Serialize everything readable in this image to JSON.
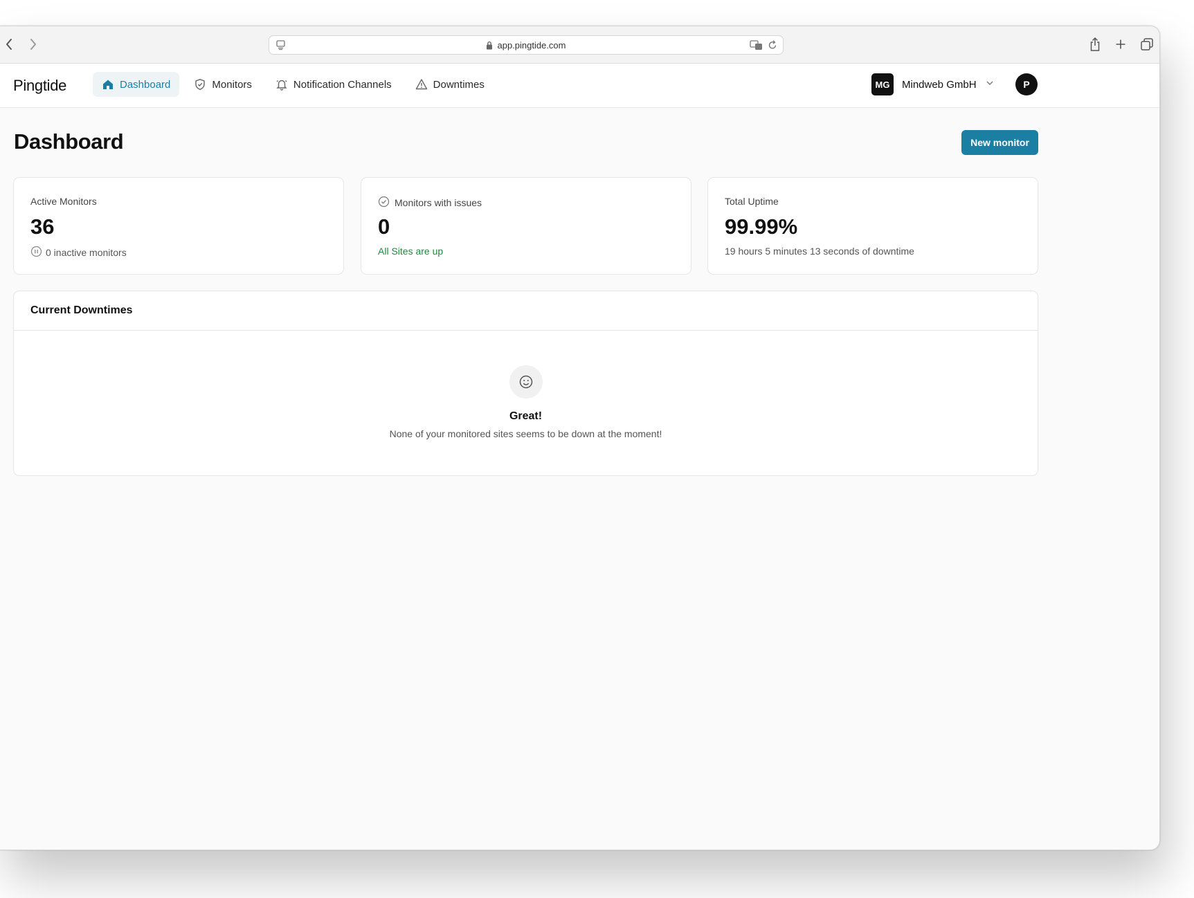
{
  "browser": {
    "url": "app.pingtide.com"
  },
  "app": {
    "logo": "Pingtide"
  },
  "nav": {
    "items": [
      {
        "label": "Dashboard",
        "icon": "home-icon",
        "active": true
      },
      {
        "label": "Monitors",
        "icon": "shield-check-icon",
        "active": false
      },
      {
        "label": "Notification Channels",
        "icon": "bell-icon",
        "active": false
      },
      {
        "label": "Downtimes",
        "icon": "warning-triangle-icon",
        "active": false
      }
    ]
  },
  "org": {
    "initials": "MG",
    "name": "Mindweb GmbH"
  },
  "user": {
    "initial": "P"
  },
  "page": {
    "title": "Dashboard",
    "new_button": "New monitor"
  },
  "stats": {
    "active": {
      "label": "Active Monitors",
      "value": "36",
      "sub": "0 inactive monitors"
    },
    "issues": {
      "label": "Monitors with issues",
      "value": "0",
      "sub": "All Sites are up"
    },
    "uptime": {
      "label": "Total Uptime",
      "value": "99.99%",
      "sub": "19 hours 5 minutes 13 seconds of downtime"
    }
  },
  "downtimes": {
    "title": "Current Downtimes",
    "empty_title": "Great!",
    "empty_desc": "None of your monitored sites seems to be down at the moment!"
  },
  "colors": {
    "accent": "#1b7fa4",
    "success": "#1f8a3d"
  }
}
